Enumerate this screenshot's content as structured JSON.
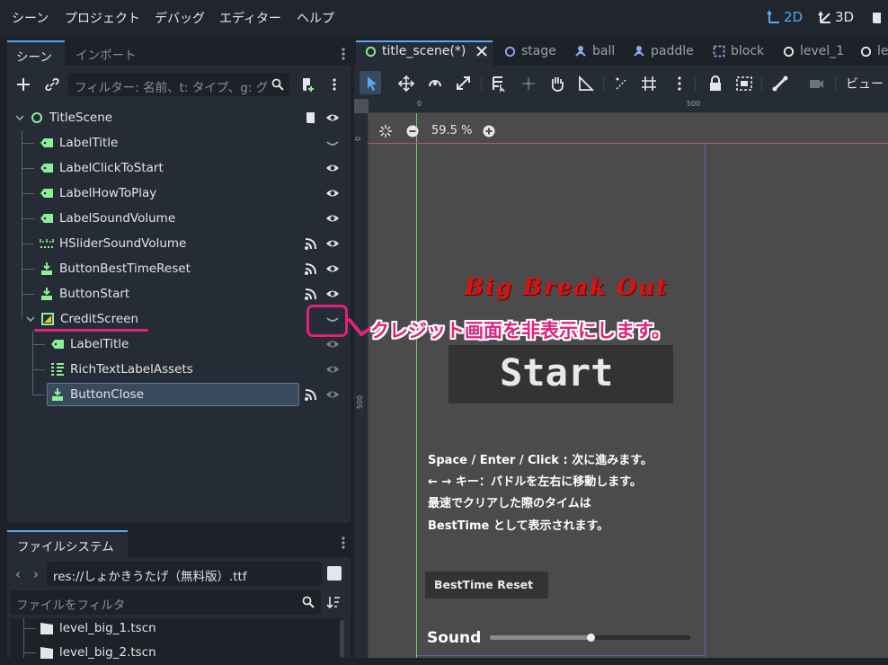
{
  "menubar": {
    "items": [
      "シーン",
      "プロジェクト",
      "デバッグ",
      "エディター",
      "ヘルプ"
    ],
    "mode_2d": "2D",
    "mode_3d": "3D"
  },
  "scene_dock": {
    "tab_scene": "シーン",
    "tab_import": "インポート",
    "filter_placeholder": "フィルター: 名前、t: タイプ、g: グ",
    "nodes": [
      {
        "label": "TitleScene"
      },
      {
        "label": "LabelTitle"
      },
      {
        "label": "LabelClickToStart"
      },
      {
        "label": "LabelHowToPlay"
      },
      {
        "label": "LabelSoundVolume"
      },
      {
        "label": "HSliderSoundVolume"
      },
      {
        "label": "ButtonBestTimeReset"
      },
      {
        "label": "ButtonStart"
      },
      {
        "label": "CreditScreen"
      },
      {
        "label": "LabelTitle"
      },
      {
        "label": "RichTextLabelAssets"
      },
      {
        "label": "ButtonClose"
      }
    ]
  },
  "filesystem_dock": {
    "tab": "ファイルシステム",
    "path": "res://しょかきうたげ（無料版）.ttf",
    "filter_placeholder": "ファイルをフィルタ",
    "files": [
      "level_big_1.tscn",
      "level_big_2.tscn"
    ]
  },
  "editor": {
    "tabs": [
      {
        "label": "title_scene(*)",
        "active": true
      },
      {
        "label": "stage"
      },
      {
        "label": "ball"
      },
      {
        "label": "paddle"
      },
      {
        "label": "block"
      },
      {
        "label": "level_1"
      },
      {
        "label": "le"
      }
    ],
    "view_menu": "ビュー",
    "zoom": "59.5 %",
    "ruler_top": [
      "0",
      "500"
    ],
    "ruler_left": [
      "0",
      "500"
    ]
  },
  "game": {
    "title": "Big Break Out",
    "start_button": "Start",
    "howto": [
      "Space / Enter / Click : 次に進みます。",
      "← → キー：パドルを左右に移動します。",
      "最速でクリアした際のタイムは",
      "BestTime として表示されます。"
    ],
    "besttime_reset": "BestTime Reset",
    "sound_label": "Sound",
    "sound_volume": 0.5
  },
  "annotation": {
    "text": "クレジット画面を非表示にします。",
    "color": "#e0217d"
  },
  "colors": {
    "accent": "#56a7f5",
    "node_green": "#8eef97",
    "title_red": "#e01010"
  }
}
